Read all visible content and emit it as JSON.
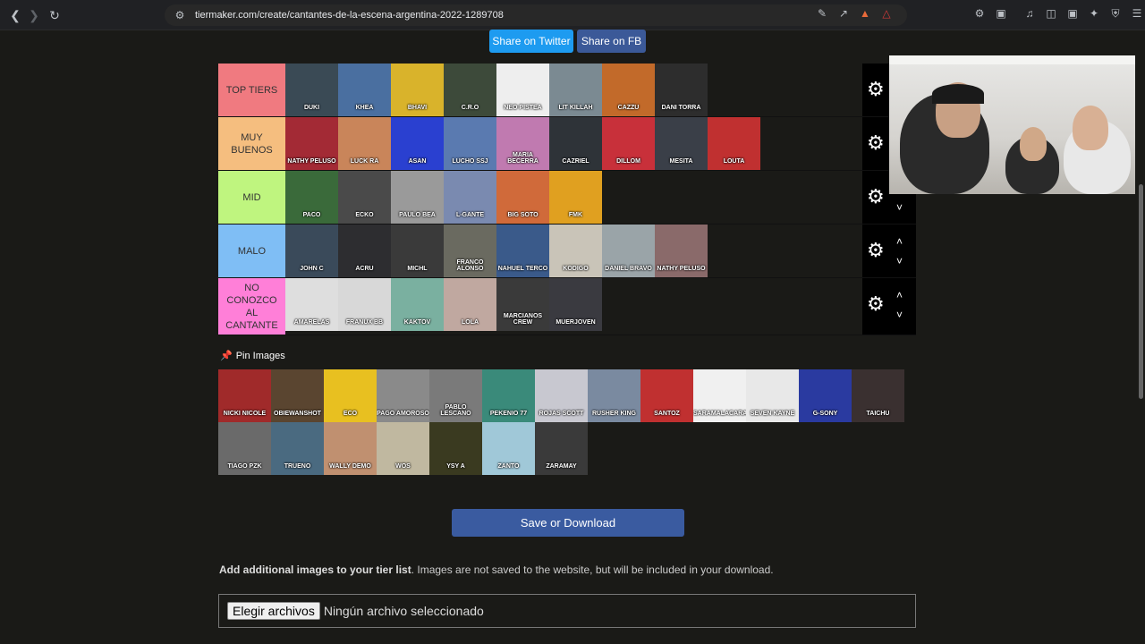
{
  "browser": {
    "url": "tiermaker.com/create/cantantes-de-la-escena-argentina-2022-1289708"
  },
  "share": {
    "twitter": "Share on Twitter",
    "facebook": "Share on FB"
  },
  "tiers": [
    {
      "label": "TOP TIERS",
      "color": "#f07a80",
      "items": [
        {
          "caption": "DUKI",
          "bg": "#3a4a55"
        },
        {
          "caption": "KHEA",
          "bg": "#4a6fa0"
        },
        {
          "caption": "BHAVI",
          "bg": "#d9b32b"
        },
        {
          "caption": "C.R.O",
          "bg": "#3d4a3a"
        },
        {
          "caption": "NEO PISTEA",
          "bg": "#eeeeee"
        },
        {
          "caption": "LIT KILLAH",
          "bg": "#7b8a92"
        },
        {
          "caption": "CAZZU",
          "bg": "#c26a2a"
        },
        {
          "caption": "DANI TORRA",
          "bg": "#2d2d2d"
        }
      ]
    },
    {
      "label": "MUY BUENOS",
      "color": "#f5be7f",
      "items": [
        {
          "caption": "NATHY PELUSO",
          "bg": "#a32a35"
        },
        {
          "caption": "LUCK RA",
          "bg": "#c9855a"
        },
        {
          "caption": "ASAN",
          "bg": "#2a40d0"
        },
        {
          "caption": "LUCHO SSJ",
          "bg": "#5a7ab0"
        },
        {
          "caption": "MARIA BECERRA",
          "bg": "#c07ab0"
        },
        {
          "caption": "CAZRIEL",
          "bg": "#2e3338"
        },
        {
          "caption": "DILLOM",
          "bg": "#c8303a"
        },
        {
          "caption": "MESITA",
          "bg": "#3a3f48"
        },
        {
          "caption": "LOUTA",
          "bg": "#c03030"
        }
      ]
    },
    {
      "label": "MID",
      "color": "#bff57f",
      "items": [
        {
          "caption": "PACO",
          "bg": "#3a6a3a"
        },
        {
          "caption": "ECKO",
          "bg": "#4a4a4a"
        },
        {
          "caption": "PAULO BEA",
          "bg": "#9a9a9a"
        },
        {
          "caption": "L-GANTE",
          "bg": "#7a8ab0"
        },
        {
          "caption": "BIG SOTO",
          "bg": "#d06a3a"
        },
        {
          "caption": "FMK",
          "bg": "#e0a020"
        }
      ]
    },
    {
      "label": "MALO",
      "color": "#7fbef5",
      "items": [
        {
          "caption": "JOHN C",
          "bg": "#3a4a5a"
        },
        {
          "caption": "ACRU",
          "bg": "#2d2d30"
        },
        {
          "caption": "MICHL",
          "bg": "#3a3a3a"
        },
        {
          "caption": "FRANCO ALONSO",
          "bg": "#6a6a60"
        },
        {
          "caption": "NAHUEL TERCO",
          "bg": "#3a5a8a"
        },
        {
          "caption": "KODIGO",
          "bg": "#c9c4b8"
        },
        {
          "caption": "DANIEL BRAVO",
          "bg": "#9aa4a8"
        },
        {
          "caption": "NATHY PELUSO",
          "bg": "#8a6a6a"
        }
      ]
    },
    {
      "label": "NO CONOZCO AL CANTANTE",
      "color": "#ff7fd8",
      "items": [
        {
          "caption": "AMARELAS",
          "bg": "#dedede"
        },
        {
          "caption": "FRANUX BB",
          "bg": "#d8d8d8"
        },
        {
          "caption": "KAKTOV",
          "bg": "#7ab0a0"
        },
        {
          "caption": "LOLA",
          "bg": "#c0a8a0"
        },
        {
          "caption": "MARCIANOS CREW",
          "bg": "#3a3a3a"
        },
        {
          "caption": "MUERJOVEN",
          "bg": "#3a3a40"
        }
      ]
    }
  ],
  "pin": {
    "title": "Pin Images",
    "items": [
      {
        "caption": "NICKI NICOLE",
        "bg": "#a02a2a"
      },
      {
        "caption": "OBIEWANSHOT",
        "bg": "#5a4530"
      },
      {
        "caption": "ECO",
        "bg": "#e8c020"
      },
      {
        "caption": "PAGO AMOROSO",
        "bg": "#8a8a8a"
      },
      {
        "caption": "PABLO LESCANO",
        "bg": "#7a7a7a"
      },
      {
        "caption": "PEKENIO 77",
        "bg": "#3a8a7a"
      },
      {
        "caption": "ROJAS SCOTT",
        "bg": "#c8c8d0"
      },
      {
        "caption": "RUSHER KING",
        "bg": "#7a8aa0"
      },
      {
        "caption": "SANTOZ",
        "bg": "#c03030"
      },
      {
        "caption": "SARAMALACARA",
        "bg": "#f0f0f0"
      },
      {
        "caption": "SEVEN KAYNE",
        "bg": "#e8e8e8"
      },
      {
        "caption": "G-SONY",
        "bg": "#2a3aa0"
      },
      {
        "caption": "TAICHU",
        "bg": "#3a3030"
      },
      {
        "caption": "TIAGO PZK",
        "bg": "#6a6a6a"
      },
      {
        "caption": "TRUENO",
        "bg": "#4a6a80"
      },
      {
        "caption": "WALLY DEMO",
        "bg": "#c09070"
      },
      {
        "caption": "WOS",
        "bg": "#c0b8a0"
      },
      {
        "caption": "YSY A",
        "bg": "#3a3a20"
      },
      {
        "caption": "ZANTO",
        "bg": "#a0c8d8"
      },
      {
        "caption": "ZARAMAY",
        "bg": "#3a3a3a"
      }
    ]
  },
  "save_button": "Save or Download",
  "add_images": {
    "bold": "Add additional images to your tier list",
    "rest": ". Images are not saved to the website, but will be included in your download."
  },
  "file_input": {
    "button": "Elegir archivos",
    "status": "Ningún archivo seleccionado"
  },
  "icons": {
    "gear": "gear-icon",
    "chevron_up": "chevron-up-icon",
    "chevron_down": "chevron-down-icon",
    "pin": "pin-icon"
  }
}
